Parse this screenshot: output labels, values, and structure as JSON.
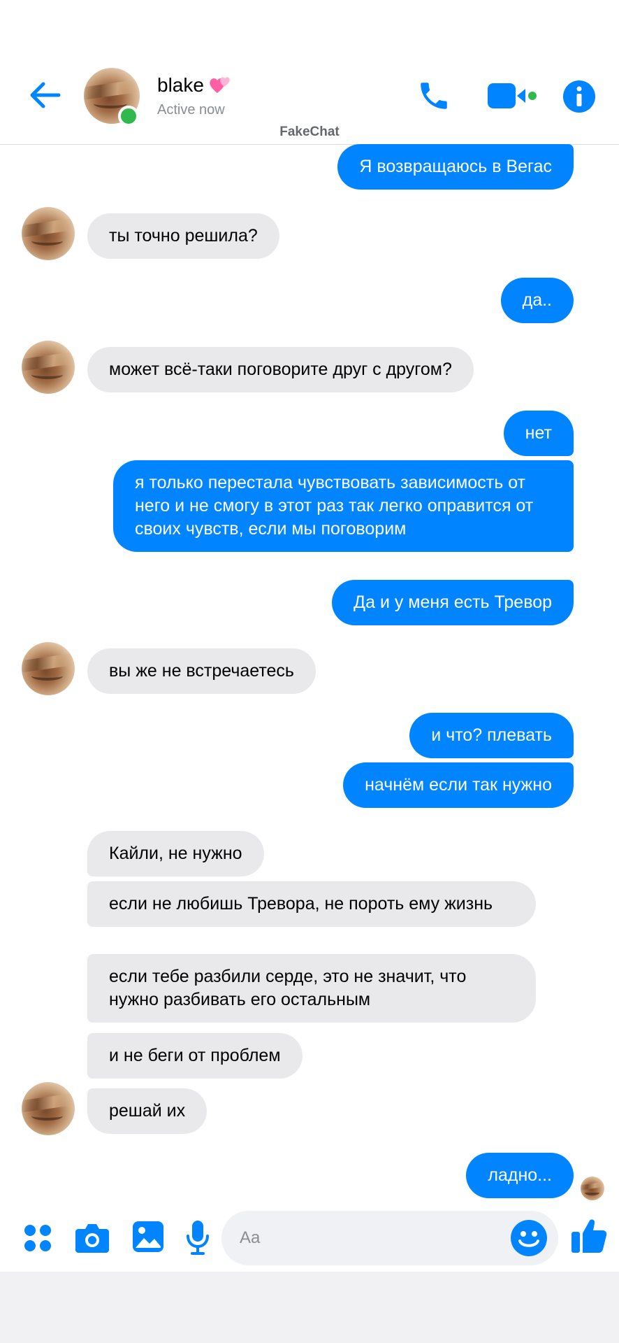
{
  "header": {
    "contact_name": "blake",
    "status": "Active now",
    "brand": "FakeChat"
  },
  "composer": {
    "placeholder": "Aa"
  },
  "messages": [
    {
      "side": "out",
      "text": "Я возвращаюсь в Вегас"
    },
    {
      "side": "in",
      "text": "ты точно решила?"
    },
    {
      "side": "out",
      "text": "да.."
    },
    {
      "side": "in",
      "text": "может всё-таки поговорите друг с другом?"
    },
    {
      "side": "out",
      "text": "нет"
    },
    {
      "side": "out",
      "text": "я только перестала чувствовать зависимость от него  и  не смогу в этот раз так легко оправится от своих чувств, если мы поговорим"
    },
    {
      "side": "out",
      "text": "Да и у меня есть Тревор"
    },
    {
      "side": "in",
      "text": "вы же не встречаетесь"
    },
    {
      "side": "out",
      "text": "и что? плевать"
    },
    {
      "side": "out",
      "text": "начнём если так нужно"
    },
    {
      "side": "in",
      "text": "Кайли, не нужно"
    },
    {
      "side": "in",
      "text": "если не любишь Тревора, не пороть ему жизнь"
    },
    {
      "side": "in",
      "text": "если тебе разбили серде, это не значит, что нужно разбивать его остальным"
    },
    {
      "side": "in",
      "text": "и не беги от проблем"
    },
    {
      "side": "in",
      "text": "решай их"
    },
    {
      "side": "out",
      "text": "ладно..."
    }
  ],
  "colors": {
    "accent": "#0084ff",
    "outgoing_bubble": "#0084ff",
    "incoming_bubble": "#e9e9eb",
    "online": "#31b94d"
  },
  "icons": [
    "back-arrow-icon",
    "phone-icon",
    "video-camera-icon",
    "info-icon",
    "apps-grid-icon",
    "camera-icon",
    "image-icon",
    "microphone-icon",
    "emoji-icon",
    "thumbs-up-icon"
  ]
}
